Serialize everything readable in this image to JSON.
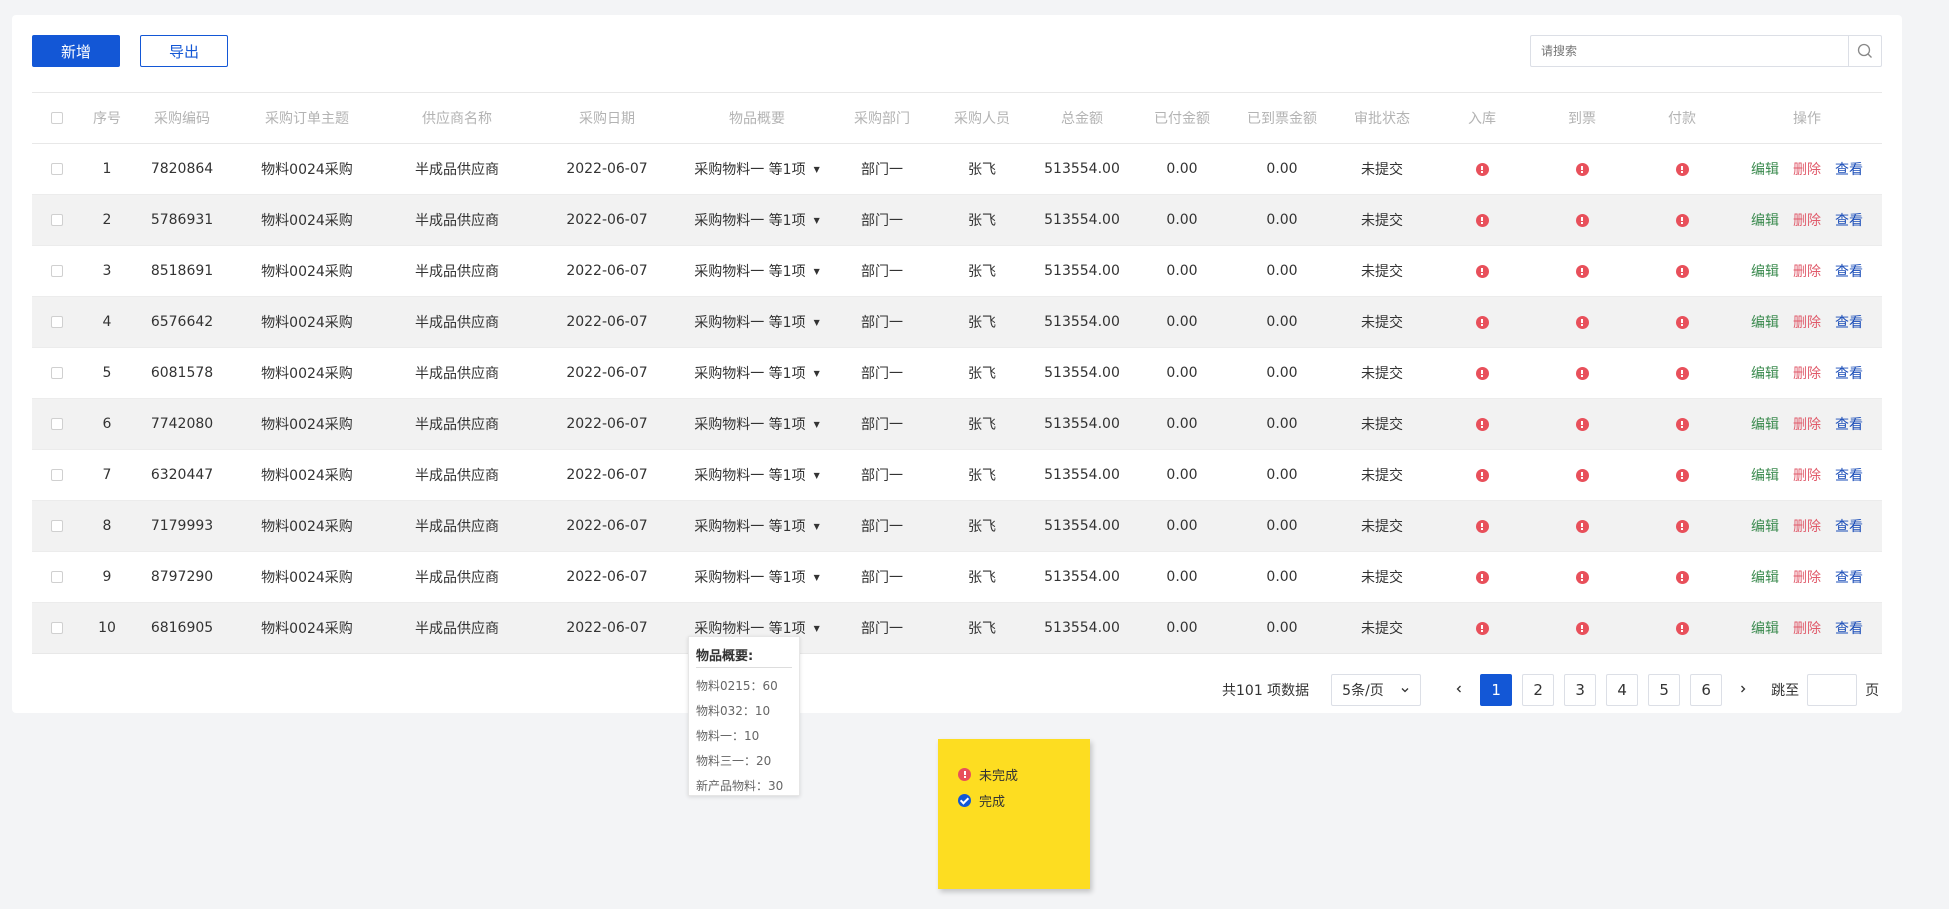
{
  "toolbar": {
    "add_label": "新增",
    "export_label": "导出"
  },
  "search": {
    "placeholder": "请搜索"
  },
  "table": {
    "headers": [
      "序号",
      "采购编码",
      "采购订单主题",
      "供应商名称",
      "采购日期",
      "物品概要",
      "采购部门",
      "采购人员",
      "总金额",
      "已付金额",
      "已到票金额",
      "审批状态",
      "入库",
      "到票",
      "付款",
      "操作"
    ],
    "rows": [
      {
        "index": "1",
        "code": "7820864",
        "subject": "物料0024采购",
        "supplier": "半成品供应商",
        "date": "2022-06-07",
        "summary": "采购物料一 等1项",
        "dept": "部门一",
        "person": "张飞",
        "total": "513554.00",
        "paid": "0.00",
        "invoiced": "0.00",
        "status": "未提交"
      },
      {
        "index": "2",
        "code": "5786931",
        "subject": "物料0024采购",
        "supplier": "半成品供应商",
        "date": "2022-06-07",
        "summary": "采购物料一 等1项",
        "dept": "部门一",
        "person": "张飞",
        "total": "513554.00",
        "paid": "0.00",
        "invoiced": "0.00",
        "status": "未提交"
      },
      {
        "index": "3",
        "code": "8518691",
        "subject": "物料0024采购",
        "supplier": "半成品供应商",
        "date": "2022-06-07",
        "summary": "采购物料一 等1项",
        "dept": "部门一",
        "person": "张飞",
        "total": "513554.00",
        "paid": "0.00",
        "invoiced": "0.00",
        "status": "未提交"
      },
      {
        "index": "4",
        "code": "6576642",
        "subject": "物料0024采购",
        "supplier": "半成品供应商",
        "date": "2022-06-07",
        "summary": "采购物料一 等1项",
        "dept": "部门一",
        "person": "张飞",
        "total": "513554.00",
        "paid": "0.00",
        "invoiced": "0.00",
        "status": "未提交"
      },
      {
        "index": "5",
        "code": "6081578",
        "subject": "物料0024采购",
        "supplier": "半成品供应商",
        "date": "2022-06-07",
        "summary": "采购物料一 等1项",
        "dept": "部门一",
        "person": "张飞",
        "total": "513554.00",
        "paid": "0.00",
        "invoiced": "0.00",
        "status": "未提交"
      },
      {
        "index": "6",
        "code": "7742080",
        "subject": "物料0024采购",
        "supplier": "半成品供应商",
        "date": "2022-06-07",
        "summary": "采购物料一 等1项",
        "dept": "部门一",
        "person": "张飞",
        "total": "513554.00",
        "paid": "0.00",
        "invoiced": "0.00",
        "status": "未提交"
      },
      {
        "index": "7",
        "code": "6320447",
        "subject": "物料0024采购",
        "supplier": "半成品供应商",
        "date": "2022-06-07",
        "summary": "采购物料一 等1项",
        "dept": "部门一",
        "person": "张飞",
        "total": "513554.00",
        "paid": "0.00",
        "invoiced": "0.00",
        "status": "未提交"
      },
      {
        "index": "8",
        "code": "7179993",
        "subject": "物料0024采购",
        "supplier": "半成品供应商",
        "date": "2022-06-07",
        "summary": "采购物料一 等1项",
        "dept": "部门一",
        "person": "张飞",
        "total": "513554.00",
        "paid": "0.00",
        "invoiced": "0.00",
        "status": "未提交"
      },
      {
        "index": "9",
        "code": "8797290",
        "subject": "物料0024采购",
        "supplier": "半成品供应商",
        "date": "2022-06-07",
        "summary": "采购物料一 等1项",
        "dept": "部门一",
        "person": "张飞",
        "total": "513554.00",
        "paid": "0.00",
        "invoiced": "0.00",
        "status": "未提交"
      },
      {
        "index": "10",
        "code": "6816905",
        "subject": "物料0024采购",
        "supplier": "半成品供应商",
        "date": "2022-06-07",
        "summary": "采购物料一 等1项",
        "dept": "部门一",
        "person": "张飞",
        "total": "513554.00",
        "paid": "0.00",
        "invoiced": "0.00",
        "status": "未提交"
      }
    ],
    "actions": {
      "edit": "编辑",
      "delete": "删除",
      "view": "查看"
    }
  },
  "tooltip": {
    "title": "物品概要:",
    "items": [
      "物料0215：60",
      "物料032：10",
      "物料一：10",
      "物料三一：20",
      "新产品物料：30"
    ]
  },
  "pagination": {
    "total_text": "共101 项数据",
    "page_size": "5条/页",
    "pages": [
      "1",
      "2",
      "3",
      "4",
      "5",
      "6"
    ],
    "current": "1",
    "jump_label": "跳至",
    "page_suffix": "页"
  },
  "legend": {
    "incomplete": "未完成",
    "complete": "完成"
  },
  "colors": {
    "primary": "#1357d6",
    "danger": "#e8505b",
    "edit": "#3a8a4e",
    "delete": "#e05a6a",
    "view": "#1a4db8",
    "legend_bg": "#fddd21"
  },
  "icons": {
    "search": "search-icon",
    "incomplete": "alert-circle-icon",
    "complete": "check-circle-icon",
    "caret": "caret-down-icon"
  }
}
